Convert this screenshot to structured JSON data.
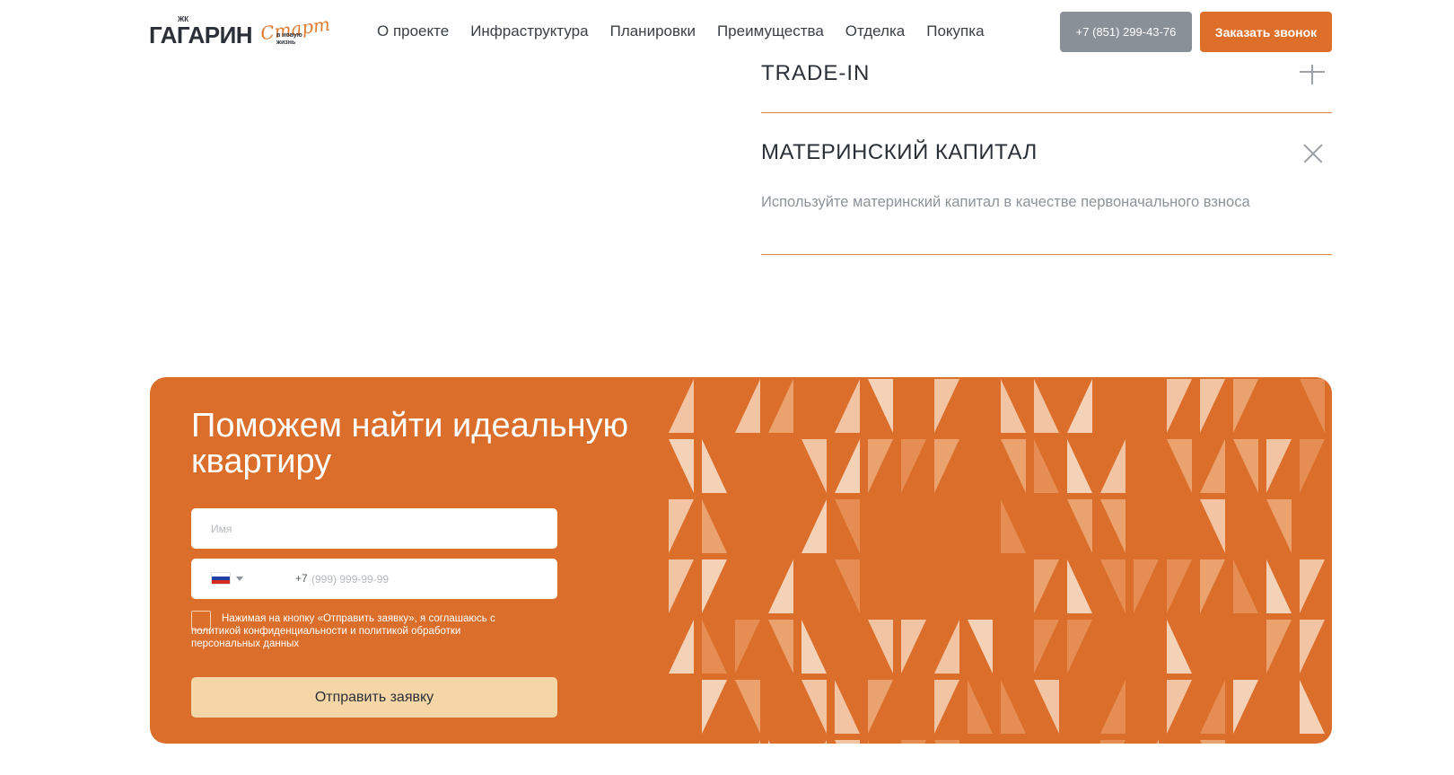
{
  "header": {
    "logo": {
      "prefix": "ЖК",
      "name": "ГАГАРИН",
      "script": "Старт",
      "tagline": "в новую жизнь"
    },
    "nav": [
      {
        "label": "О проекте"
      },
      {
        "label": "Инфраструктура"
      },
      {
        "label": "Планировки"
      },
      {
        "label": "Преимущества"
      },
      {
        "label": "Отделка"
      },
      {
        "label": "Покупка"
      }
    ],
    "phone_label": "+7 (851) 299-43-76",
    "callback_label": "Заказать звонок"
  },
  "accordion": [
    {
      "title": "TRADE-IN",
      "expanded": false
    },
    {
      "title": "МАТЕРИНСКИЙ КАПИТАЛ",
      "expanded": true,
      "description": "Используйте материнский капитал в качестве первоначального взноса"
    }
  ],
  "cta": {
    "title": "Поможем найти идеальную квартиру",
    "name_placeholder": "Имя",
    "phone_code": "+7",
    "phone_placeholder": "(999) 999-99-99",
    "consent": "Нажимая на кнопку «Отправить заявку», я соглашаюсь с политикой конфиденциальности и политикой обработки персональных данных",
    "submit_label": "Отправить заявку"
  },
  "colors": {
    "accent": "#de6f2a",
    "phone_button": "#8a9097",
    "submit_button": "#f5d6a6",
    "divider": "#de8a4e"
  },
  "icons": [
    "plus-icon",
    "close-icon",
    "flag-icon",
    "chevron-down-icon"
  ]
}
